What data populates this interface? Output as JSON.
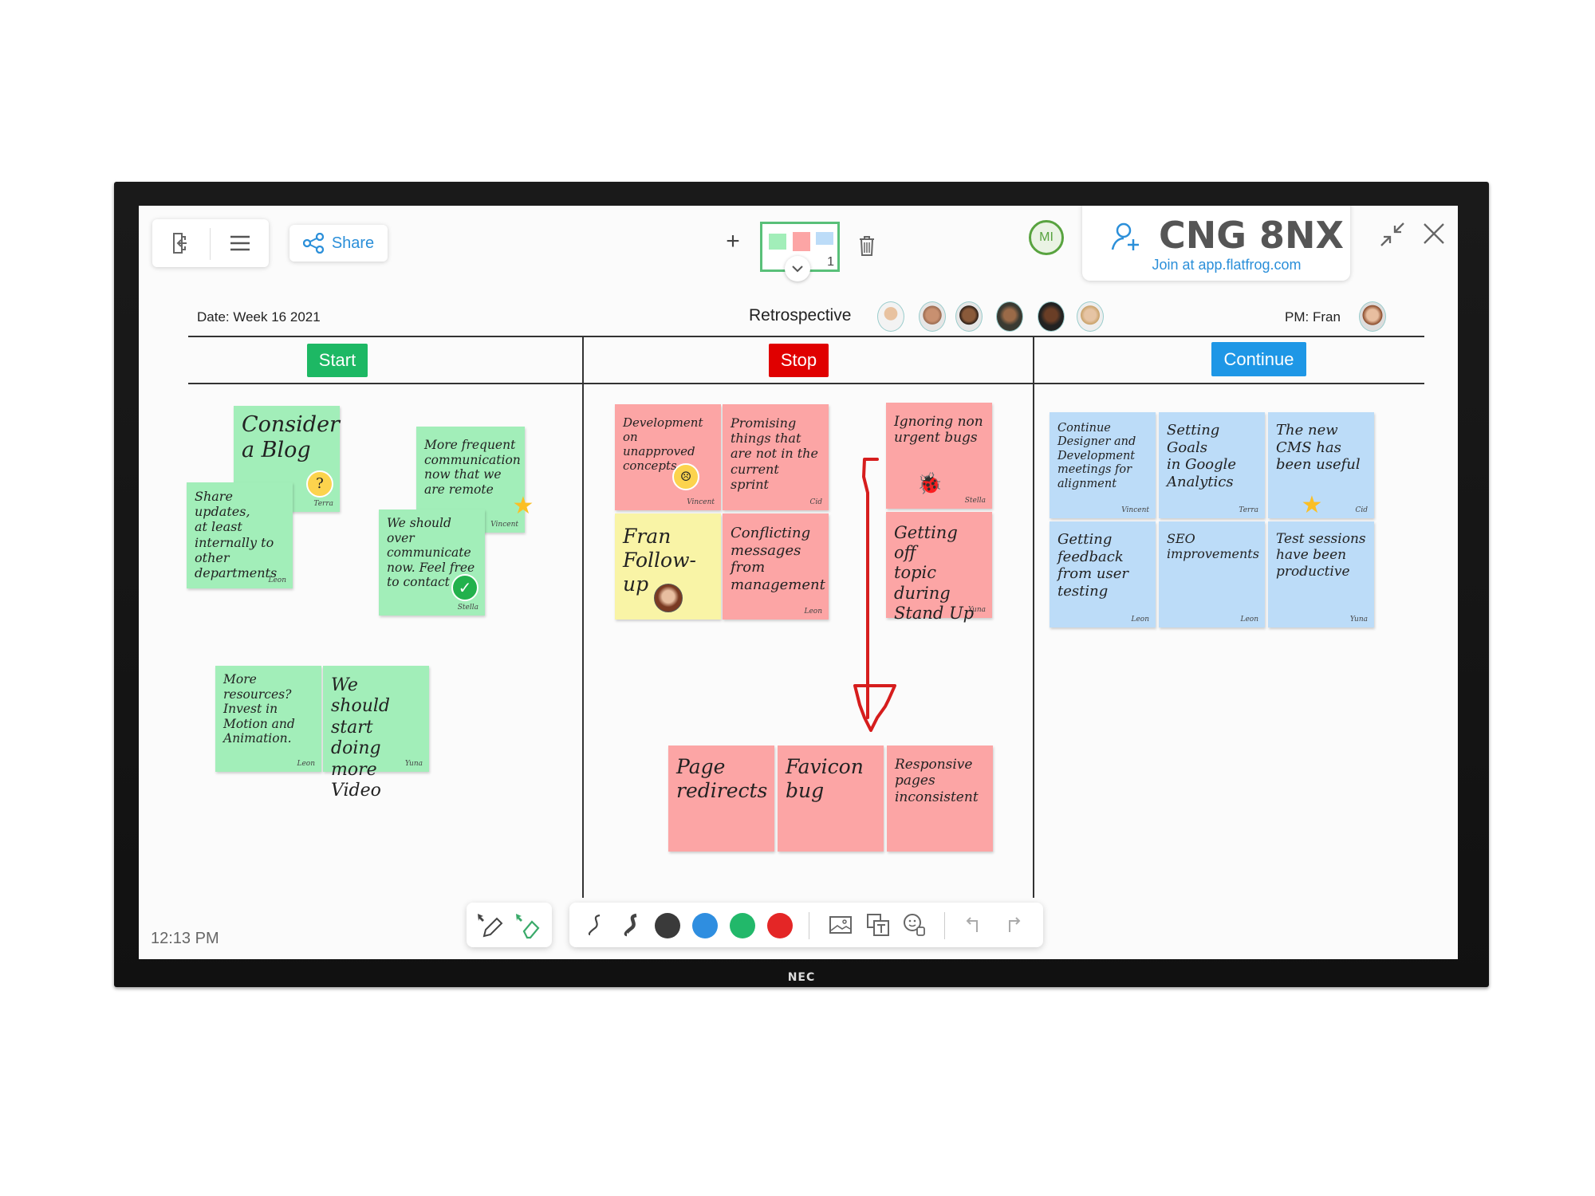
{
  "device": {
    "brand_logo": "NEC"
  },
  "top_bar": {
    "exit_icon": "exit-icon",
    "menu_icon": "hamburger-menu-icon",
    "share_label": "Share",
    "share_icon": "share-nodes-icon",
    "add_page_label": "+",
    "page_thumbnail_number": "1",
    "expand_icon": "chevron-down-icon",
    "delete_icon": "trash-icon",
    "user_initials": "MI",
    "room_code": "CNG 8NX",
    "join_text": "Join at app.flatfrog.com",
    "add_user_icon": "add-user-icon",
    "minimize_icon": "minimize-arrows-icon",
    "close_icon": "close-icon"
  },
  "board": {
    "date_label": "Date: Week 16 2021",
    "title": "Retrospective",
    "participants": [
      "participant-1",
      "participant-2",
      "participant-3",
      "participant-4",
      "participant-5",
      "participant-6"
    ],
    "pm_label": "PM: Fran",
    "columns": [
      {
        "label": "Start",
        "color": "#1db864"
      },
      {
        "label": "Stop",
        "color": "#e00000"
      },
      {
        "label": "Continue",
        "color": "#1e97e6"
      }
    ]
  },
  "stickies": {
    "start": [
      {
        "text": "Consider\na Blog",
        "author": "Terra",
        "emoji": "thinking-face"
      },
      {
        "text": "Share updates,\nat least\ninternally to\nother\ndepartments",
        "author": "Leon"
      },
      {
        "text": "More frequent\ncommunication\nnow that we\nare remote",
        "author": "Vincent",
        "emoji": "star"
      },
      {
        "text": "We should over\ncommunicate\nnow. Feel free\nto contact",
        "author": "Stella",
        "emoji": "check-mark"
      },
      {
        "text": "More resources?\nInvest in\nMotion and\nAnimation.",
        "author": "Leon"
      },
      {
        "text": "We should\nstart doing\nmore Video",
        "author": "Yuna"
      }
    ],
    "stop": [
      {
        "text": "Development on\nunapproved\nconcepts",
        "author": "Vincent",
        "emoji": "worried-face"
      },
      {
        "text": "Promising\nthings that\nare not in the\ncurrent sprint",
        "author": "Cid"
      },
      {
        "text": "Fran\nFollow-up",
        "author": "",
        "emoji": "avatar-fran"
      },
      {
        "text": "Conflicting\nmessages\nfrom\nmanagement",
        "author": "Leon"
      },
      {
        "text": "Ignoring non\nurgent bugs",
        "author": "Stella",
        "emoji": "ladybug"
      },
      {
        "text": "Getting off\ntopic during\nStand Up",
        "author": "Yuna"
      },
      {
        "text": "Page\nredirects",
        "author": ""
      },
      {
        "text": "Favicon\nbug",
        "author": ""
      },
      {
        "text": "Responsive\npages\ninconsistent",
        "author": ""
      }
    ],
    "continue": [
      {
        "text": "Continue\nDesigner and\nDevelopment\nmeetings for\nalignment",
        "author": "Vincent"
      },
      {
        "text": "Setting Goals\nin Google\nAnalytics",
        "author": "Terra"
      },
      {
        "text": "The new\nCMS has\nbeen useful",
        "author": "Cid",
        "emoji": "star"
      },
      {
        "text": "Getting\nfeedback\nfrom user\ntesting",
        "author": "Leon"
      },
      {
        "text": "SEO\nimprovements",
        "author": "Leon"
      },
      {
        "text": "Test sessions\nhave been\nproductive",
        "author": "Yuna"
      }
    ]
  },
  "clock": "12:13 PM",
  "bottom_toolbar": {
    "tools": [
      "pen-select-icon",
      "eraser-select-icon"
    ],
    "pens": [
      "thin-pen-icon",
      "thick-pen-icon"
    ],
    "colors": [
      "#3a3a3a",
      "#2f8ee0",
      "#22b86a",
      "#e42626"
    ],
    "actions": [
      "image-icon",
      "sticky-note-icon",
      "sticker-icon"
    ],
    "history": [
      "undo-icon",
      "redo-icon"
    ]
  }
}
